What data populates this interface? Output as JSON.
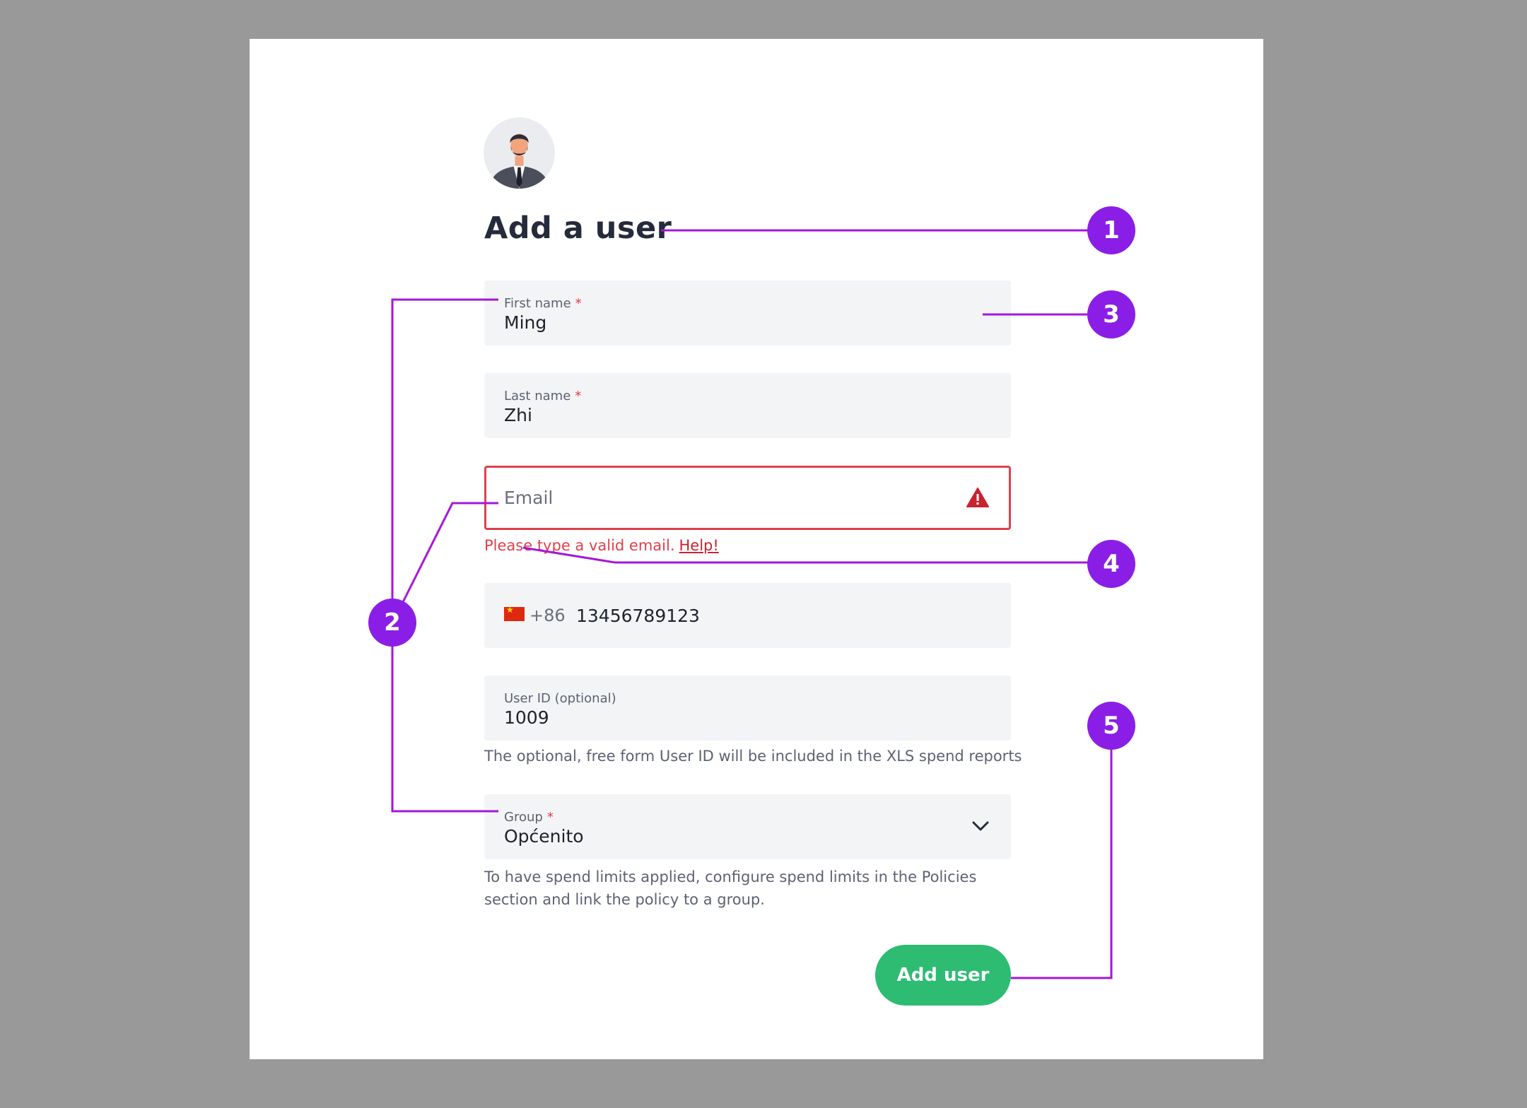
{
  "form": {
    "title": "Add a user",
    "first_name": {
      "label": "First name",
      "required_mark": "*",
      "value": "Ming"
    },
    "last_name": {
      "label": "Last name",
      "required_mark": "*",
      "value": "Zhi"
    },
    "email": {
      "placeholder": "Email",
      "error_text": "Please type a valid email.",
      "help_link": "Help!"
    },
    "phone": {
      "country_flag": "china-flag",
      "country_code": "+86",
      "number": "13456789123"
    },
    "user_id": {
      "label": "User ID (optional)",
      "value": "1009",
      "help": "The optional, free form User ID will be included in the XLS spend reports"
    },
    "group": {
      "label": "Group",
      "required_mark": "*",
      "value": "Općenito",
      "help": "To have spend limits applied, configure spend limits in the Policies section and link the policy to a group."
    },
    "submit_label": "Add user"
  },
  "annotations": {
    "markers": [
      "1",
      "2",
      "3",
      "4",
      "5"
    ],
    "color": "#8a1ee6"
  },
  "colors": {
    "accent_green": "#2dbc72",
    "error_red": "#e0404b",
    "field_bg": "#f3f4f6"
  }
}
